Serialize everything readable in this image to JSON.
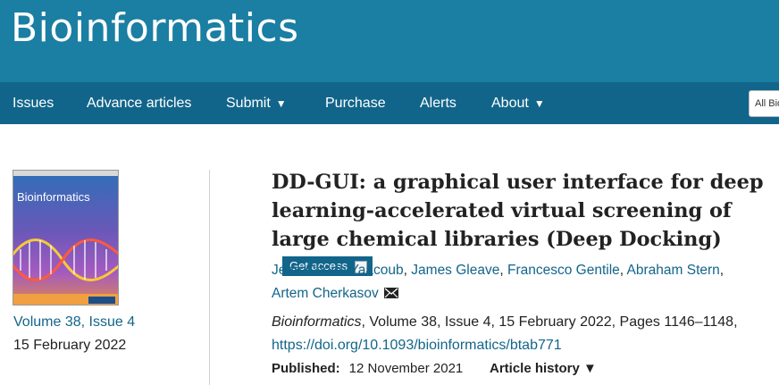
{
  "header": {
    "brand": "Bioinformatics"
  },
  "nav": {
    "items": [
      {
        "label": "Issues"
      },
      {
        "label": "Advance articles"
      },
      {
        "label": "Submit",
        "caret": "▼"
      },
      {
        "label": "Purchase"
      },
      {
        "label": "Alerts"
      },
      {
        "label": "About",
        "caret": "▼"
      }
    ],
    "search_label": "All Bio"
  },
  "sidebar": {
    "cover_title": "Bioinformatics",
    "volume_link": "Volume 38, Issue 4",
    "issue_date": "15 February 2022"
  },
  "article": {
    "title": "DD-GUI: a graphical user interface for deep learning-accelerated virtual screening of large chemical libraries (Deep Docking)",
    "access_label": "Get access",
    "authors": [
      "Jean Charle Yaacoub",
      "James Gleave",
      "Francesco Gentile",
      "Abraham Stern",
      "Artem Cherkasov"
    ],
    "journal": "Bioinformatics",
    "citation_rest": ", Volume 38, Issue 4, 15 February 2022, Pages 1146–1148,",
    "doi": "https://doi.org/10.1093/bioinformatics/btab771",
    "published_label": "Published:",
    "published_date": "12 November 2021",
    "history_label": "Article history",
    "history_caret": "▼"
  },
  "colors": {
    "masthead": "#1b7ea3",
    "navbar": "#12658a",
    "link": "#12658a"
  }
}
